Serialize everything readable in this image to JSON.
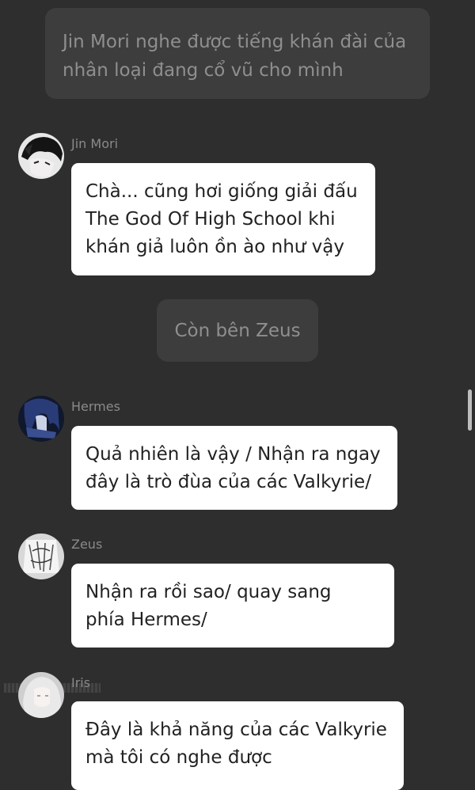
{
  "narration": [
    "Jin Mori nghe được tiếng khán đài của\nnhân loại đang cổ vũ cho mình",
    "Còn bên Zeus"
  ],
  "messages": [
    {
      "sender": "Jin Mori",
      "text": "Chà... cũng hơi giống giải đấu\nThe God Of High School khi\nkhán giả luôn ồn ào như vậy",
      "avatar_icon": "jin-mori-avatar"
    },
    {
      "sender": "Hermes",
      "text": "Quả nhiên là vậy / Nhận ra ngay\nđây là trò đùa của các Valkyrie/",
      "avatar_icon": "hermes-avatar"
    },
    {
      "sender": "Zeus",
      "text": "Nhận ra rồi sao/ quay sang\nphía Hermes/",
      "avatar_icon": "zeus-avatar"
    },
    {
      "sender": "Iris",
      "text": "Đây là khả năng của các Valkyrie\nmà tôi có nghe được",
      "avatar_icon": "iris-avatar"
    }
  ],
  "colors": {
    "background": "#2e2e2e",
    "narration_bg": "#3d3d3d",
    "narration_text": "#8f8f8f",
    "bubble_bg": "#ffffff",
    "bubble_text": "#222222",
    "name_text": "#8a8a8a"
  }
}
